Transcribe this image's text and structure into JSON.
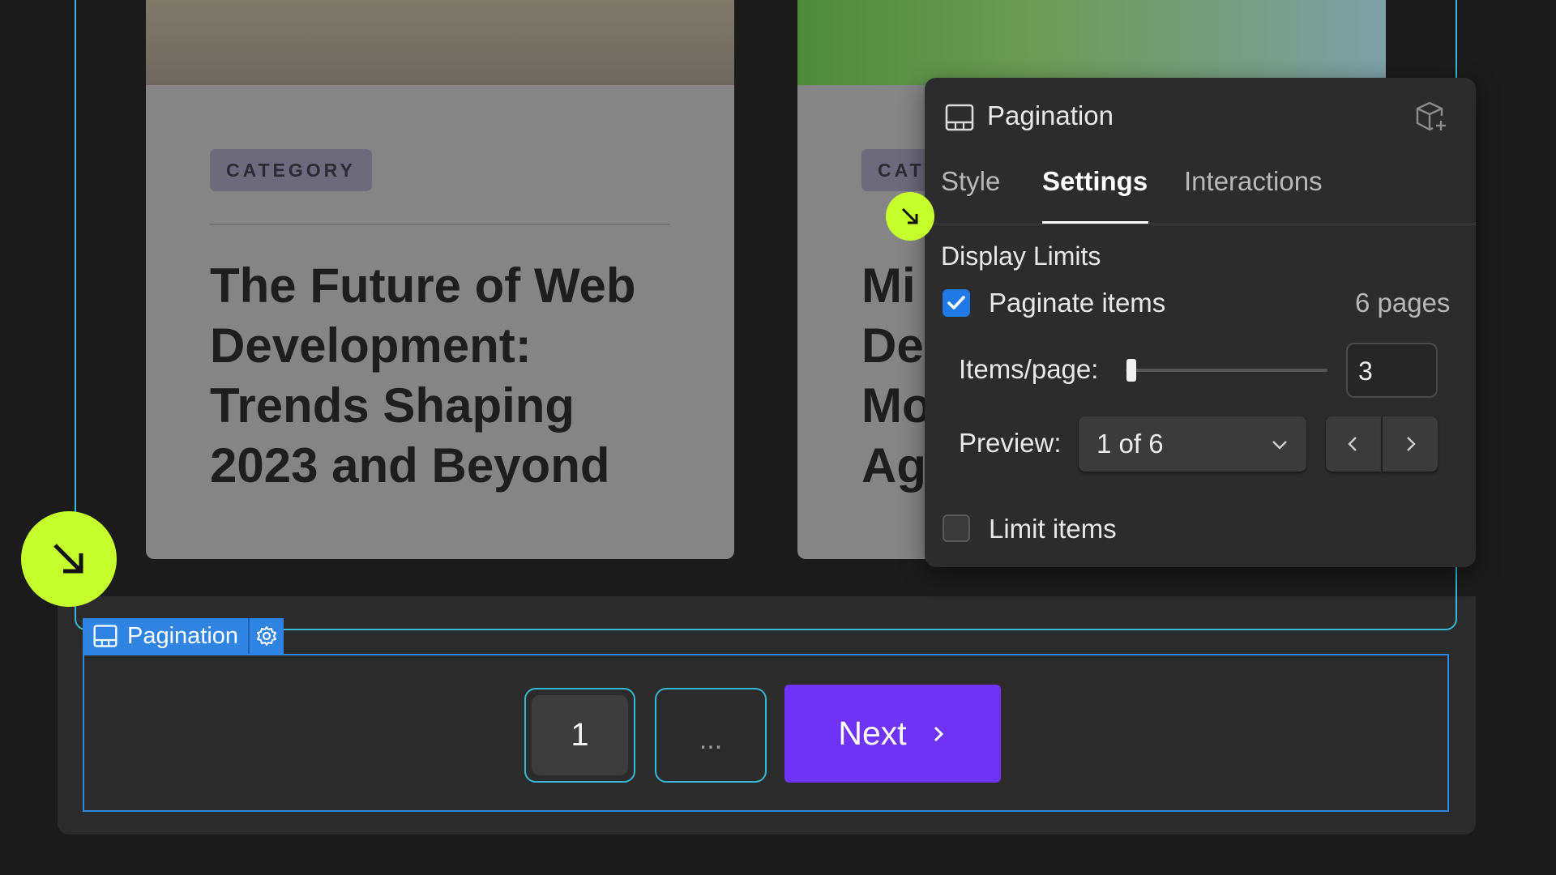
{
  "cards": [
    {
      "category": "CATEGORY",
      "title_lines": [
        "The Future of Web",
        "Development:",
        "Trends Shaping",
        "2023 and Beyond"
      ]
    },
    {
      "category_partial": "CAT",
      "title_lines_partial": [
        "Mi",
        "De",
        "Mo",
        "Ag"
      ]
    }
  ],
  "settings_panel": {
    "title": "Pagination",
    "tabs": [
      {
        "label": "Style",
        "active": false
      },
      {
        "label": "Settings",
        "active": true
      },
      {
        "label": "Interactions",
        "active": false
      }
    ],
    "section_title": "Display Limits",
    "paginate_items": {
      "label": "Paginate items",
      "checked": true,
      "pages_text": "6 pages"
    },
    "items_per_page": {
      "label": "Items/page:",
      "value": "3",
      "slider_fraction": 0.02
    },
    "preview": {
      "label": "Preview:",
      "selected": "1 of 6"
    },
    "limit_items": {
      "label": "Limit items",
      "checked": false
    }
  },
  "element_label": {
    "name": "Pagination"
  },
  "pagination": {
    "page_number": "1",
    "ellipsis": "...",
    "next_label": "Next"
  },
  "colors": {
    "accent_purple": "#6e34f5",
    "selection_blue": "#2e87e6",
    "outline_cyan": "#35b8d2",
    "cursor_lime": "#c6ff2e",
    "checkbox_blue": "#1f7ae8"
  },
  "icons": [
    "pagination-component-icon",
    "add-component-icon",
    "gear-icon",
    "chevron-down-icon",
    "chevron-left-icon",
    "chevron-right-icon",
    "checkmark-icon",
    "cursor-arrow-icon"
  ]
}
